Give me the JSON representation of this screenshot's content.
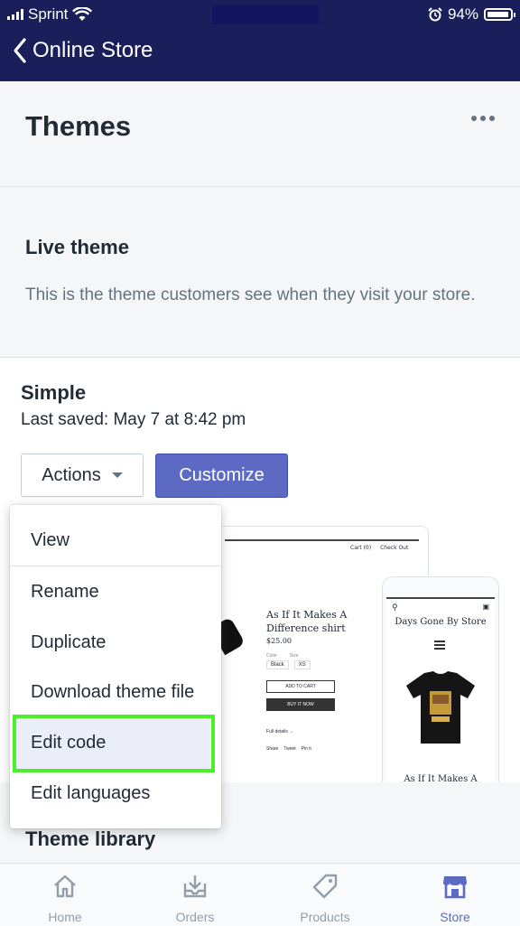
{
  "status_bar": {
    "carrier": "Sprint",
    "battery_percent": "94%",
    "battery_level": 0.94
  },
  "nav": {
    "back_label": "Online Store"
  },
  "header": {
    "title": "Themes",
    "more_icon": "more-horizontal-icon"
  },
  "live_theme": {
    "heading": "Live theme",
    "description": "This is the theme customers see when they visit your store."
  },
  "theme_card": {
    "name": "Simple",
    "last_saved": "Last saved: May 7 at 8:42 pm",
    "actions_label": "Actions",
    "customize_label": "Customize"
  },
  "preview": {
    "cart": "Cart (0)",
    "checkout": "Check Out",
    "product_title": "As If It Makes A Difference shirt",
    "price": "$25.00",
    "color_label": "Color",
    "size_label": "Size",
    "color_value": "Black",
    "size_value": "XS",
    "add_to_cart": "ADD TO CART",
    "buy_now": "BUY IT NOW",
    "full_details": "Full details →",
    "share": "Share",
    "tweet": "Tweet",
    "pin": "Pin it",
    "store_name": "Days Gone By Store",
    "mobile_product_title": "As If It Makes A"
  },
  "dropdown": {
    "items": [
      "View",
      "Rename",
      "Duplicate",
      "Download theme file",
      "Edit code",
      "Edit languages"
    ],
    "highlighted": "Edit code"
  },
  "library": {
    "heading": "Theme library"
  },
  "tabs": [
    {
      "label": "Home",
      "icon": "home-icon",
      "active": false
    },
    {
      "label": "Orders",
      "icon": "orders-icon",
      "active": false
    },
    {
      "label": "Products",
      "icon": "tag-icon",
      "active": false
    },
    {
      "label": "Store",
      "icon": "store-icon",
      "active": true
    }
  ],
  "colors": {
    "nav_bg": "#1a1f5c",
    "primary": "#5c6ac4",
    "highlight_border": "#4cf02a"
  }
}
